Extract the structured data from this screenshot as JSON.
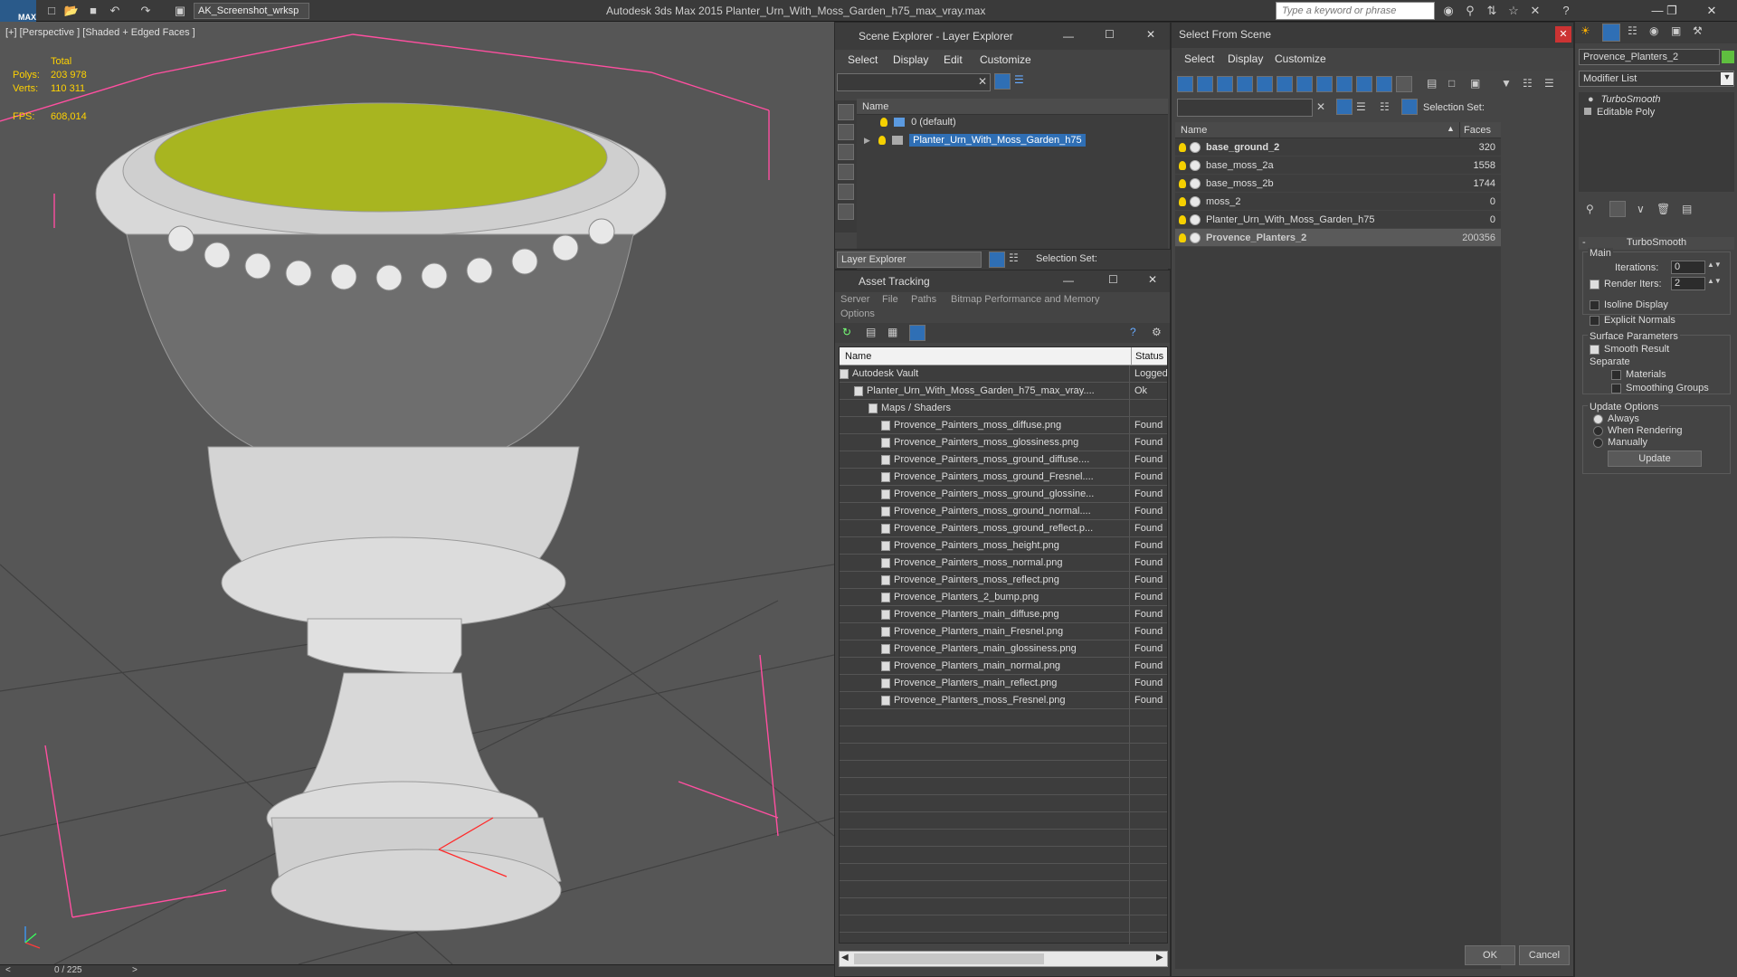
{
  "titlebar": {
    "logo": "MAX",
    "workspace": "AK_Screenshot_wrksp",
    "app_title": "Autodesk 3ds Max  2015     Planter_Urn_With_Moss_Garden_h75_max_vray.max",
    "search_placeholder": "Type a keyword or phrase"
  },
  "viewport": {
    "label": "[+] [Perspective ] [Shaded + Edged Faces ]",
    "total_label": "Total",
    "polys_label": "Polys:",
    "polys_value": "203 978",
    "verts_label": "Verts:",
    "verts_value": "110 311",
    "fps_label": "FPS:",
    "fps_value": "608,014"
  },
  "timeline": {
    "frame": "0 / 225",
    "prev": "<",
    "next": ">"
  },
  "scene_explorer": {
    "title": "Scene Explorer - Layer Explorer",
    "menus": [
      "Select",
      "Display",
      "Edit",
      "Customize"
    ],
    "col_name": "Name",
    "layers": [
      "0 (default)",
      "Planter_Urn_With_Moss_Garden_h75"
    ],
    "footer_combo": "Layer Explorer",
    "selection_set": "Selection Set:"
  },
  "asset_tracking": {
    "title": "Asset Tracking",
    "menus": [
      "Server",
      "File",
      "Paths",
      "Bitmap Performance and Memory",
      "Options"
    ],
    "col_name": "Name",
    "col_status": "Status",
    "rows": [
      {
        "name": "Autodesk Vault",
        "status": "Logged"
      },
      {
        "name": "Planter_Urn_With_Moss_Garden_h75_max_vray....",
        "status": "Ok"
      },
      {
        "name": "Maps / Shaders",
        "status": ""
      },
      {
        "name": "Provence_Painters_moss_diffuse.png",
        "status": "Found"
      },
      {
        "name": "Provence_Painters_moss_glossiness.png",
        "status": "Found"
      },
      {
        "name": "Provence_Painters_moss_ground_diffuse....",
        "status": "Found"
      },
      {
        "name": "Provence_Painters_moss_ground_Fresnel....",
        "status": "Found"
      },
      {
        "name": "Provence_Painters_moss_ground_glossine...",
        "status": "Found"
      },
      {
        "name": "Provence_Painters_moss_ground_normal....",
        "status": "Found"
      },
      {
        "name": "Provence_Painters_moss_ground_reflect.p...",
        "status": "Found"
      },
      {
        "name": "Provence_Painters_moss_height.png",
        "status": "Found"
      },
      {
        "name": "Provence_Painters_moss_normal.png",
        "status": "Found"
      },
      {
        "name": "Provence_Painters_moss_reflect.png",
        "status": "Found"
      },
      {
        "name": "Provence_Planters_2_bump.png",
        "status": "Found"
      },
      {
        "name": "Provence_Planters_main_diffuse.png",
        "status": "Found"
      },
      {
        "name": "Provence_Planters_main_Fresnel.png",
        "status": "Found"
      },
      {
        "name": "Provence_Planters_main_glossiness.png",
        "status": "Found"
      },
      {
        "name": "Provence_Planters_main_normal.png",
        "status": "Found"
      },
      {
        "name": "Provence_Planters_main_reflect.png",
        "status": "Found"
      },
      {
        "name": "Provence_Planters_moss_Fresnel.png",
        "status": "Found"
      }
    ]
  },
  "select_from_scene": {
    "title": "Select From Scene",
    "menus": [
      "Select",
      "Display",
      "Customize"
    ],
    "selection_set": "Selection Set:",
    "col_name": "Name",
    "col_faces": "Faces",
    "rows": [
      {
        "name": "base_ground_2",
        "faces": "320"
      },
      {
        "name": "base_moss_2a",
        "faces": "1558"
      },
      {
        "name": "base_moss_2b",
        "faces": "1744"
      },
      {
        "name": "moss_2",
        "faces": "0"
      },
      {
        "name": "Planter_Urn_With_Moss_Garden_h75",
        "faces": "0"
      },
      {
        "name": "Provence_Planters_2",
        "faces": "200356"
      }
    ],
    "ok": "OK",
    "cancel": "Cancel"
  },
  "command_panel": {
    "object_name": "Provence_Planters_2",
    "modifier_list": "Modifier List",
    "stack": [
      "TurboSmooth",
      "Editable Poly"
    ],
    "rollout": "TurboSmooth",
    "main": "Main",
    "iterations_label": "Iterations:",
    "iterations": "0",
    "render_iters_label": "Render Iters:",
    "render_iters": "2",
    "isoline": "Isoline Display",
    "explicit": "Explicit Normals",
    "surface": "Surface Parameters",
    "smooth": "Smooth Result",
    "separate": "Separate",
    "materials": "Materials",
    "smoothing_groups": "Smoothing Groups",
    "update_options": "Update Options",
    "always": "Always",
    "when_rendering": "When Rendering",
    "manually": "Manually",
    "update": "Update"
  },
  "colors": {
    "accent": "#2f6fb5",
    "stat_yellow": "#ffd200",
    "moss": "#a8b520"
  }
}
